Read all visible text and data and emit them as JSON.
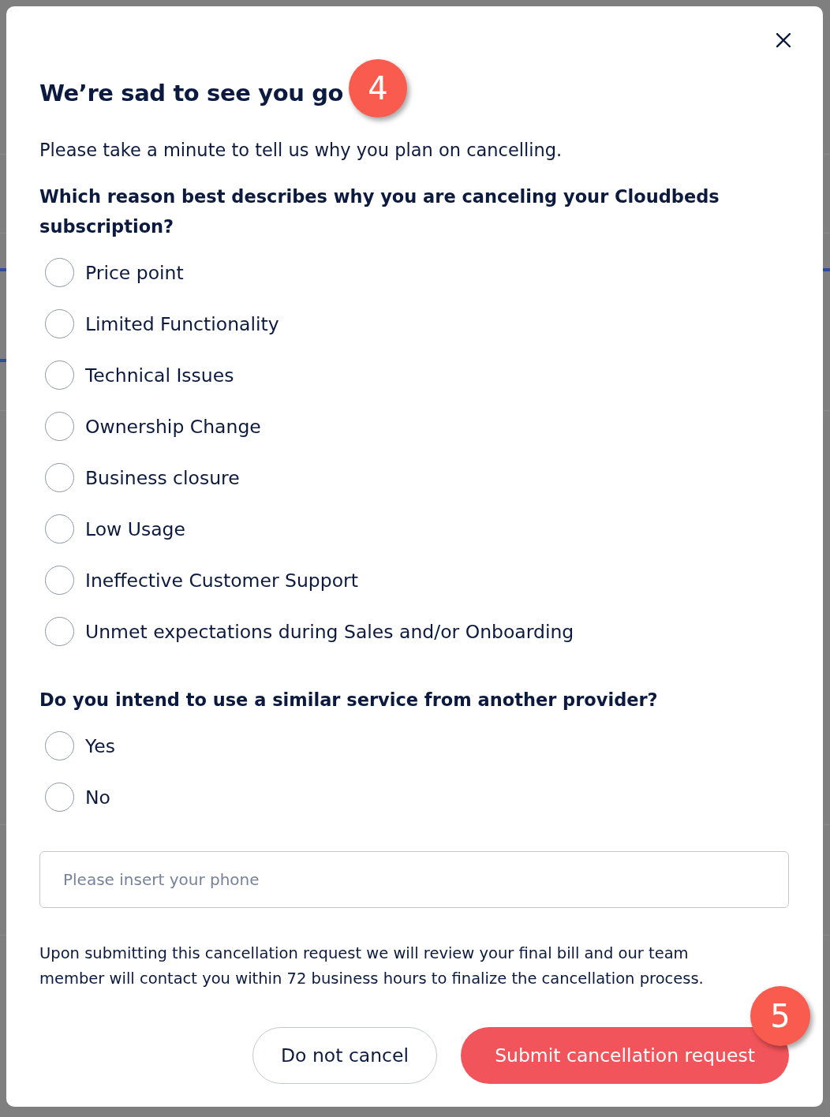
{
  "dialog": {
    "title": "We’re sad to see you go",
    "title_badge": "4",
    "intro": "Please take a minute to tell us why you plan on cancelling.",
    "questions": [
      {
        "label": "Which reason best describes why you are canceling your Cloudbeds subscription?",
        "options": [
          {
            "label": "Price point",
            "selected": false
          },
          {
            "label": "Limited Functionality",
            "selected": false
          },
          {
            "label": "Technical Issues",
            "selected": false
          },
          {
            "label": "Ownership Change",
            "selected": false
          },
          {
            "label": "Business closure",
            "selected": false
          },
          {
            "label": "Low Usage",
            "selected": false
          },
          {
            "label": "Ineffective Customer Support",
            "selected": false
          },
          {
            "label": "Unmet expectations during Sales and/or Onboarding",
            "selected": false
          }
        ]
      },
      {
        "label": "Do you intend to use a similar service from another provider?",
        "options": [
          {
            "label": "Yes",
            "selected": false
          },
          {
            "label": "No",
            "selected": false
          }
        ]
      }
    ],
    "phone_field": {
      "placeholder": "Please insert your phone"
    },
    "notice": "Upon submitting this cancellation request we will review your final bill and our team member will contact you within 72 business hours to finalize the cancellation process.",
    "buttons": [
      {
        "label": "Do not cancel",
        "kind": "secondary"
      },
      {
        "label": "Submit cancellation request",
        "kind": "primary",
        "badge": "5"
      }
    ]
  }
}
